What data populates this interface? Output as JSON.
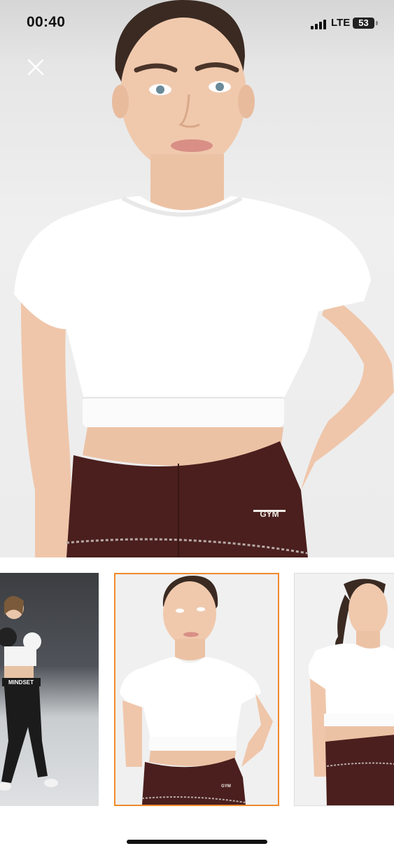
{
  "status_bar": {
    "time": "00:40",
    "network": "LTE",
    "battery": "53"
  },
  "viewer": {
    "close_icon": "close-icon",
    "main_image": "model-white-crop-top-front",
    "main_logo_text": "GYM",
    "thumbnails": [
      {
        "name": "model-boxing-black-leggings",
        "selected": false,
        "logo_text": "MINDSET"
      },
      {
        "name": "model-white-crop-top-front",
        "selected": true,
        "logo_text": "GYM"
      },
      {
        "name": "model-white-crop-top-side",
        "selected": false,
        "logo_text": ""
      }
    ]
  },
  "colors": {
    "selected_border": "#f08a2b",
    "top": "#ffffff",
    "leggings": "#4a1f1d"
  }
}
